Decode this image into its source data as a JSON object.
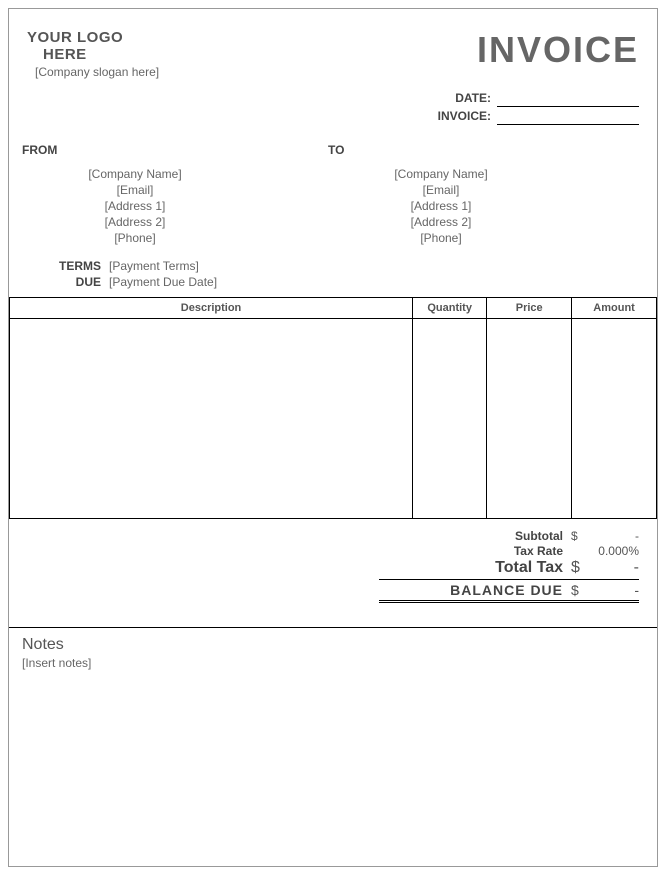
{
  "header": {
    "logo_line1": "YOUR LOGO",
    "logo_line2": "HERE",
    "slogan": "[Company slogan here]",
    "title": "INVOICE"
  },
  "meta": {
    "date_label": "DATE:",
    "date_value": "",
    "invoice_label": "INVOICE:",
    "invoice_value": ""
  },
  "from": {
    "head": "FROM",
    "company": "[Company Name]",
    "email": "[Email]",
    "address1": "[Address 1]",
    "address2": "[Address 2]",
    "phone": "[Phone]"
  },
  "to": {
    "head": "TO",
    "company": "[Company Name]",
    "email": "[Email]",
    "address1": "[Address 1]",
    "address2": "[Address 2]",
    "phone": "[Phone]"
  },
  "terms": {
    "terms_label": "TERMS",
    "terms_value": "[Payment Terms]",
    "due_label": "DUE",
    "due_value": "[Payment Due Date]"
  },
  "table": {
    "headers": {
      "description": "Description",
      "quantity": "Quantity",
      "price": "Price",
      "amount": "Amount"
    }
  },
  "totals": {
    "subtotal_label": "Subtotal",
    "subtotal_currency": "$",
    "subtotal_value": "-",
    "taxrate_label": "Tax Rate",
    "taxrate_value": "0.000%",
    "totaltax_label": "Total Tax",
    "totaltax_currency": "$",
    "totaltax_value": "-",
    "balance_label": "BALANCE DUE",
    "balance_currency": "$",
    "balance_value": "-"
  },
  "notes": {
    "head": "Notes",
    "body": "[Insert notes]"
  }
}
